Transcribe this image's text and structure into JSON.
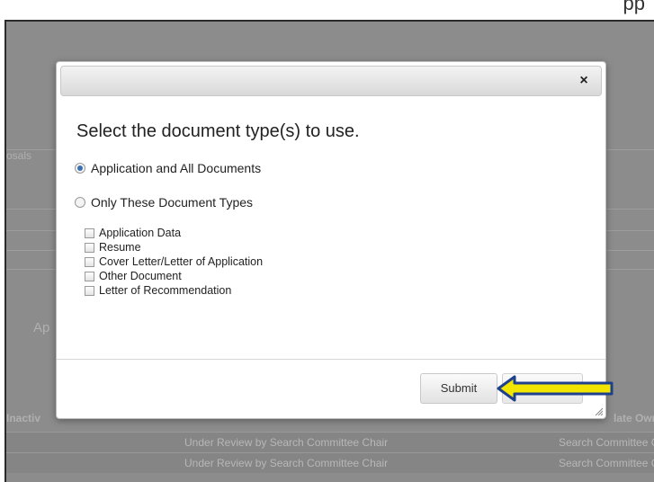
{
  "page": {
    "top_label": "pp"
  },
  "background": {
    "labels": [
      "osals",
      "Ap"
    ],
    "table_header_left": "Inactiv",
    "table_header_right": "late Owr",
    "rows": [
      {
        "status": "Under Review by Search Committee Chair",
        "owner": "Search Committee C"
      },
      {
        "status": "Under Review by Search Committee Chair",
        "owner": "Search Committee C"
      }
    ]
  },
  "dialog": {
    "close_label": "×",
    "heading": "Select the document type(s) to use.",
    "options": [
      {
        "label": "Application and All Documents",
        "checked": true
      },
      {
        "label": "Only These Document Types",
        "checked": false
      }
    ],
    "document_types": [
      {
        "label": "Application Data",
        "checked": false
      },
      {
        "label": "Resume",
        "checked": false
      },
      {
        "label": "Cover Letter/Letter of Application",
        "checked": false
      },
      {
        "label": "Other Document",
        "checked": false
      },
      {
        "label": "Letter of Recommendation",
        "checked": false
      }
    ],
    "submit_label": "Submit"
  },
  "annotation": {
    "arrow_color": "#f2e600",
    "arrow_outline": "#1f3f8f"
  }
}
